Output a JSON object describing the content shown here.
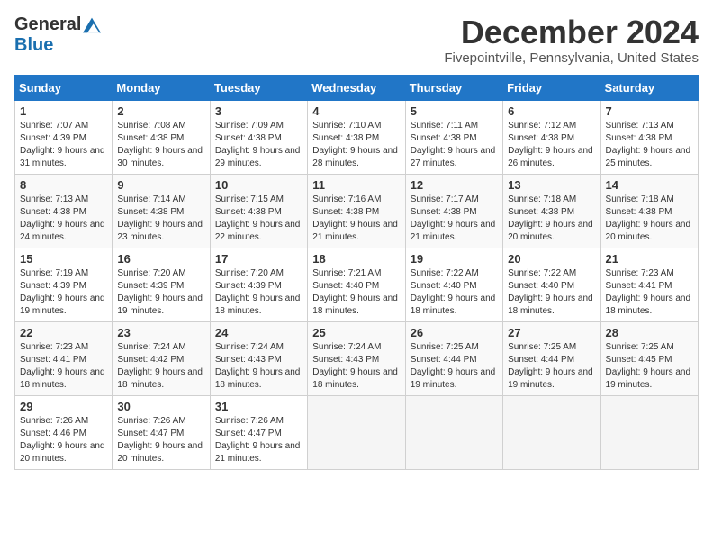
{
  "logo": {
    "general": "General",
    "blue": "Blue"
  },
  "title": "December 2024",
  "location": "Fivepointville, Pennsylvania, United States",
  "days_of_week": [
    "Sunday",
    "Monday",
    "Tuesday",
    "Wednesday",
    "Thursday",
    "Friday",
    "Saturday"
  ],
  "weeks": [
    [
      {
        "day": "1",
        "sunrise": "7:07 AM",
        "sunset": "4:39 PM",
        "daylight": "9 hours and 31 minutes."
      },
      {
        "day": "2",
        "sunrise": "7:08 AM",
        "sunset": "4:38 PM",
        "daylight": "9 hours and 30 minutes."
      },
      {
        "day": "3",
        "sunrise": "7:09 AM",
        "sunset": "4:38 PM",
        "daylight": "9 hours and 29 minutes."
      },
      {
        "day": "4",
        "sunrise": "7:10 AM",
        "sunset": "4:38 PM",
        "daylight": "9 hours and 28 minutes."
      },
      {
        "day": "5",
        "sunrise": "7:11 AM",
        "sunset": "4:38 PM",
        "daylight": "9 hours and 27 minutes."
      },
      {
        "day": "6",
        "sunrise": "7:12 AM",
        "sunset": "4:38 PM",
        "daylight": "9 hours and 26 minutes."
      },
      {
        "day": "7",
        "sunrise": "7:13 AM",
        "sunset": "4:38 PM",
        "daylight": "9 hours and 25 minutes."
      }
    ],
    [
      {
        "day": "8",
        "sunrise": "7:13 AM",
        "sunset": "4:38 PM",
        "daylight": "9 hours and 24 minutes."
      },
      {
        "day": "9",
        "sunrise": "7:14 AM",
        "sunset": "4:38 PM",
        "daylight": "9 hours and 23 minutes."
      },
      {
        "day": "10",
        "sunrise": "7:15 AM",
        "sunset": "4:38 PM",
        "daylight": "9 hours and 22 minutes."
      },
      {
        "day": "11",
        "sunrise": "7:16 AM",
        "sunset": "4:38 PM",
        "daylight": "9 hours and 21 minutes."
      },
      {
        "day": "12",
        "sunrise": "7:17 AM",
        "sunset": "4:38 PM",
        "daylight": "9 hours and 21 minutes."
      },
      {
        "day": "13",
        "sunrise": "7:18 AM",
        "sunset": "4:38 PM",
        "daylight": "9 hours and 20 minutes."
      },
      {
        "day": "14",
        "sunrise": "7:18 AM",
        "sunset": "4:38 PM",
        "daylight": "9 hours and 20 minutes."
      }
    ],
    [
      {
        "day": "15",
        "sunrise": "7:19 AM",
        "sunset": "4:39 PM",
        "daylight": "9 hours and 19 minutes."
      },
      {
        "day": "16",
        "sunrise": "7:20 AM",
        "sunset": "4:39 PM",
        "daylight": "9 hours and 19 minutes."
      },
      {
        "day": "17",
        "sunrise": "7:20 AM",
        "sunset": "4:39 PM",
        "daylight": "9 hours and 18 minutes."
      },
      {
        "day": "18",
        "sunrise": "7:21 AM",
        "sunset": "4:40 PM",
        "daylight": "9 hours and 18 minutes."
      },
      {
        "day": "19",
        "sunrise": "7:22 AM",
        "sunset": "4:40 PM",
        "daylight": "9 hours and 18 minutes."
      },
      {
        "day": "20",
        "sunrise": "7:22 AM",
        "sunset": "4:40 PM",
        "daylight": "9 hours and 18 minutes."
      },
      {
        "day": "21",
        "sunrise": "7:23 AM",
        "sunset": "4:41 PM",
        "daylight": "9 hours and 18 minutes."
      }
    ],
    [
      {
        "day": "22",
        "sunrise": "7:23 AM",
        "sunset": "4:41 PM",
        "daylight": "9 hours and 18 minutes."
      },
      {
        "day": "23",
        "sunrise": "7:24 AM",
        "sunset": "4:42 PM",
        "daylight": "9 hours and 18 minutes."
      },
      {
        "day": "24",
        "sunrise": "7:24 AM",
        "sunset": "4:43 PM",
        "daylight": "9 hours and 18 minutes."
      },
      {
        "day": "25",
        "sunrise": "7:24 AM",
        "sunset": "4:43 PM",
        "daylight": "9 hours and 18 minutes."
      },
      {
        "day": "26",
        "sunrise": "7:25 AM",
        "sunset": "4:44 PM",
        "daylight": "9 hours and 19 minutes."
      },
      {
        "day": "27",
        "sunrise": "7:25 AM",
        "sunset": "4:44 PM",
        "daylight": "9 hours and 19 minutes."
      },
      {
        "day": "28",
        "sunrise": "7:25 AM",
        "sunset": "4:45 PM",
        "daylight": "9 hours and 19 minutes."
      }
    ],
    [
      {
        "day": "29",
        "sunrise": "7:26 AM",
        "sunset": "4:46 PM",
        "daylight": "9 hours and 20 minutes."
      },
      {
        "day": "30",
        "sunrise": "7:26 AM",
        "sunset": "4:47 PM",
        "daylight": "9 hours and 20 minutes."
      },
      {
        "day": "31",
        "sunrise": "7:26 AM",
        "sunset": "4:47 PM",
        "daylight": "9 hours and 21 minutes."
      },
      null,
      null,
      null,
      null
    ]
  ]
}
